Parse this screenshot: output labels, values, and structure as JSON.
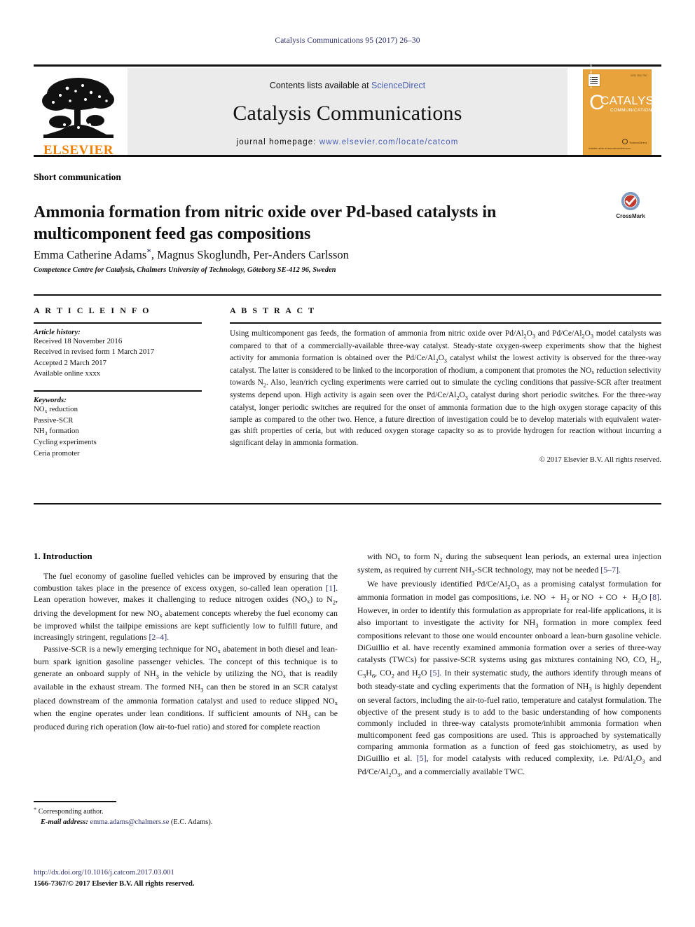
{
  "running_head": "Catalysis Communications 95 (2017) 26–30",
  "masthead": {
    "publisher_logo_text": "ELSEVIER",
    "contents_prefix": "Contents lists available at ",
    "contents_link": "ScienceDirect",
    "journal_title": "Catalysis Communications",
    "homepage_label": "journal homepage:",
    "homepage_url": "www.elsevier.com/locate/catcom",
    "cover": {
      "big_letter": "C",
      "title": "CATALYSIS",
      "subtitle": "COMMUNICATIONS",
      "spine_text": "CATALYSIS COMMUNICATIONS",
      "issn_note": "ISSN 1566-7367",
      "footer_note": "Available online at www.sciencedirect.com",
      "science_direct": "ScienceDirect"
    }
  },
  "article": {
    "section_type": "Short communication",
    "title": "Ammonia formation from nitric oxide over Pd-based catalysts in multicomponent feed gas compositions",
    "authors_html": "Emma Catherine Adams<span class=\"star supstar\">*</span>, Magnus Skoglundh, Per-Anders Carlsson",
    "affiliation": "Competence Centre for Catalysis, Chalmers University of Technology, Göteborg SE-412 96, Sweden",
    "crossmark_label": "CrossMark"
  },
  "article_info": {
    "heading": "A R T I C L E   I N F O",
    "history_label": "Article history:",
    "history": [
      "Received 18 November 2016",
      "Received in revised form 1 March 2017",
      "Accepted 2 March 2017",
      "Available online xxxx"
    ],
    "keywords_label": "Keywords:",
    "keywords_html": [
      "NO<span class=\"sub\">x</span> reduction",
      "Passive-SCR",
      "NH<sub>3</sub> formation",
      "Cycling experiments",
      "Ceria promoter"
    ]
  },
  "abstract": {
    "heading": "A B S T R A C T",
    "text_html": "Using multicomponent gas feeds, the formation of ammonia from nitric oxide over Pd/Al<sub>2</sub>O<sub>3</sub> and Pd/Ce/Al<sub>2</sub>O<sub>3</sub> model catalysts was compared to that of a commercially-available three-way catalyst. Steady-state oxygen-sweep experiments show that the highest activity for ammonia formation is obtained over the Pd/Ce/Al<sub>2</sub>O<sub>3</sub> catalyst whilst the lowest activity is observed for the three-way catalyst. The latter is considered to be linked to the incorporation of rhodium, a component that promotes the NO<span class=\"sub\">x</span> reduction selectivity towards N<sub>2</sub>. Also, lean/rich cycling experiments were carried out to simulate the cycling conditions that passive-SCR after treatment systems depend upon. High activity is again seen over the Pd/Ce/Al<sub>2</sub>O<sub>3</sub> catalyst during short periodic switches. For the three-way catalyst, longer periodic switches are required for the onset of ammonia formation due to the high oxygen storage capacity of this sample as compared to the other two. Hence, a future direction of investigation could be to develop materials with equivalent water-gas shift properties of ceria, but with reduced oxygen storage capacity so as to provide hydrogen for reaction without incurring a significant delay in ammonia formation.",
    "copyright": "© 2017 Elsevier B.V. All rights reserved."
  },
  "introduction": {
    "heading": "1. Introduction",
    "left_paragraphs_html": [
      "The fuel economy of gasoline fuelled vehicles can be improved by ensuring that the combustion takes place in the presence of excess oxygen, so-called lean operation <span class=\"ref\">[1]</span>. Lean operation however, makes it challenging to reduce nitrogen oxides (NO<span class=\"sub\">x</span>) to N<sub>2</sub>, driving the development for new NO<span class=\"sub\">x</span> abatement concepts whereby the fuel economy can be improved whilst the tailpipe emissions are kept sufficiently low to fulfill future, and increasingly stringent, regulations <span class=\"ref\">[2–4]</span>.",
      "Passive-SCR is a newly emerging technique for NO<span class=\"sub\">x</span> abatement in both diesel and lean-burn spark ignition gasoline passenger vehicles. The concept of this technique is to generate an onboard supply of NH<sub>3</sub> in the vehicle by utilizing the NO<span class=\"sub\">x</span> that is readily available in the exhaust stream. The formed NH<sub>3</sub> can then be stored in an SCR catalyst placed downstream of the ammonia formation catalyst and used to reduce slipped NO<span class=\"sub\">x</span> when the engine operates under lean conditions. If sufficient amounts of NH<sub>3</sub> can be produced during rich operation (low air-to-fuel ratio) and stored for complete reaction"
    ],
    "right_paragraphs_html": [
      "with NO<span class=\"sub\">x</span> to form N<sub>2</sub> during the subsequent lean periods, an external urea injection system, as required by current NH<sub>3</sub>-SCR technology, may not be needed <span class=\"ref\">[5–7]</span>.",
      "We have previously identified Pd/Ce/Al<sub>2</sub>O<sub>3</sub> as a promising catalyst formulation for ammonia formation in model gas compositions, i.e. NO&nbsp; +&nbsp; H<sub>2</sub> or NO&nbsp; + CO&nbsp; +&nbsp; H<sub>2</sub>O <span class=\"ref\">[8]</span>. However, in order to identify this formulation as appropriate for real-life applications, it is also important to investigate the activity for NH<sub>3</sub> formation in more complex feed compositions relevant to those one would encounter onboard a lean-burn gasoline vehicle. DiGuillio et al. have recently examined ammonia formation over a series of three-way catalysts (TWCs) for passive-SCR systems using gas mixtures containing NO, CO, H<sub>2</sub>, C<sub>3</sub>H<sub>6</sub>, CO<sub>2</sub> and H<sub>2</sub>O <span class=\"ref\">[5]</span>. In their systematic study, the authors identify through means of both steady-state and cycling experiments that the formation of NH<sub>3</sub> is highly dependent on several factors, including the air-to-fuel ratio, temperature and catalyst formulation. The objective of the present study is to add to the basic understanding of how components commonly included in three-way catalysts promote/inhibit ammonia formation when multicomponent feed gas compositions are used. This is approached by systematically comparing ammonia formation as a function of feed gas stoichiometry, as used by DiGuillio et al. <span class=\"ref\">[5]</span>, for model catalysts with reduced complexity, i.e. Pd/Al<sub>2</sub>O<sub>3</sub> and Pd/Ce/Al<sub>2</sub>O<sub>3</sub>, and a commercially available TWC."
    ]
  },
  "footer": {
    "corresponding_author": "Corresponding author.",
    "email_label": "E-mail address:",
    "email": "emma.adams@chalmers.se",
    "email_owner": "(E.C. Adams).",
    "doi": "http://dx.doi.org/10.1016/j.catcom.2017.03.001",
    "issn_line": "1566-7367/© 2017 Elsevier B.V. All rights reserved."
  }
}
